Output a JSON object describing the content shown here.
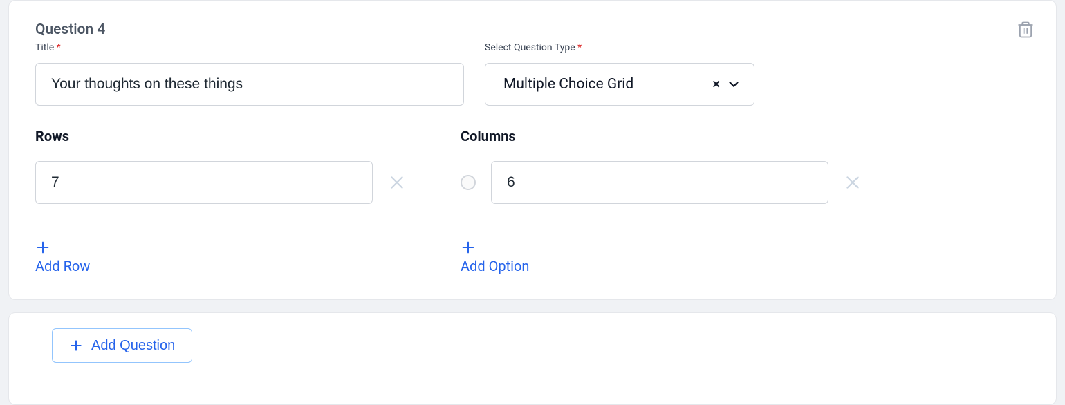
{
  "question": {
    "header": "Question 4",
    "title_label": "Title",
    "title_value": "Your thoughts on these things",
    "type_label": "Select Question Type",
    "type_value": "Multiple Choice Grid",
    "rows_label": "Rows",
    "columns_label": "Columns",
    "rows": [
      {
        "value": "7"
      }
    ],
    "columns": [
      {
        "value": "6"
      }
    ],
    "add_row_label": "Add Row",
    "add_option_label": "Add Option"
  },
  "footer": {
    "add_question_label": "Add Question"
  },
  "required_marker": "*"
}
